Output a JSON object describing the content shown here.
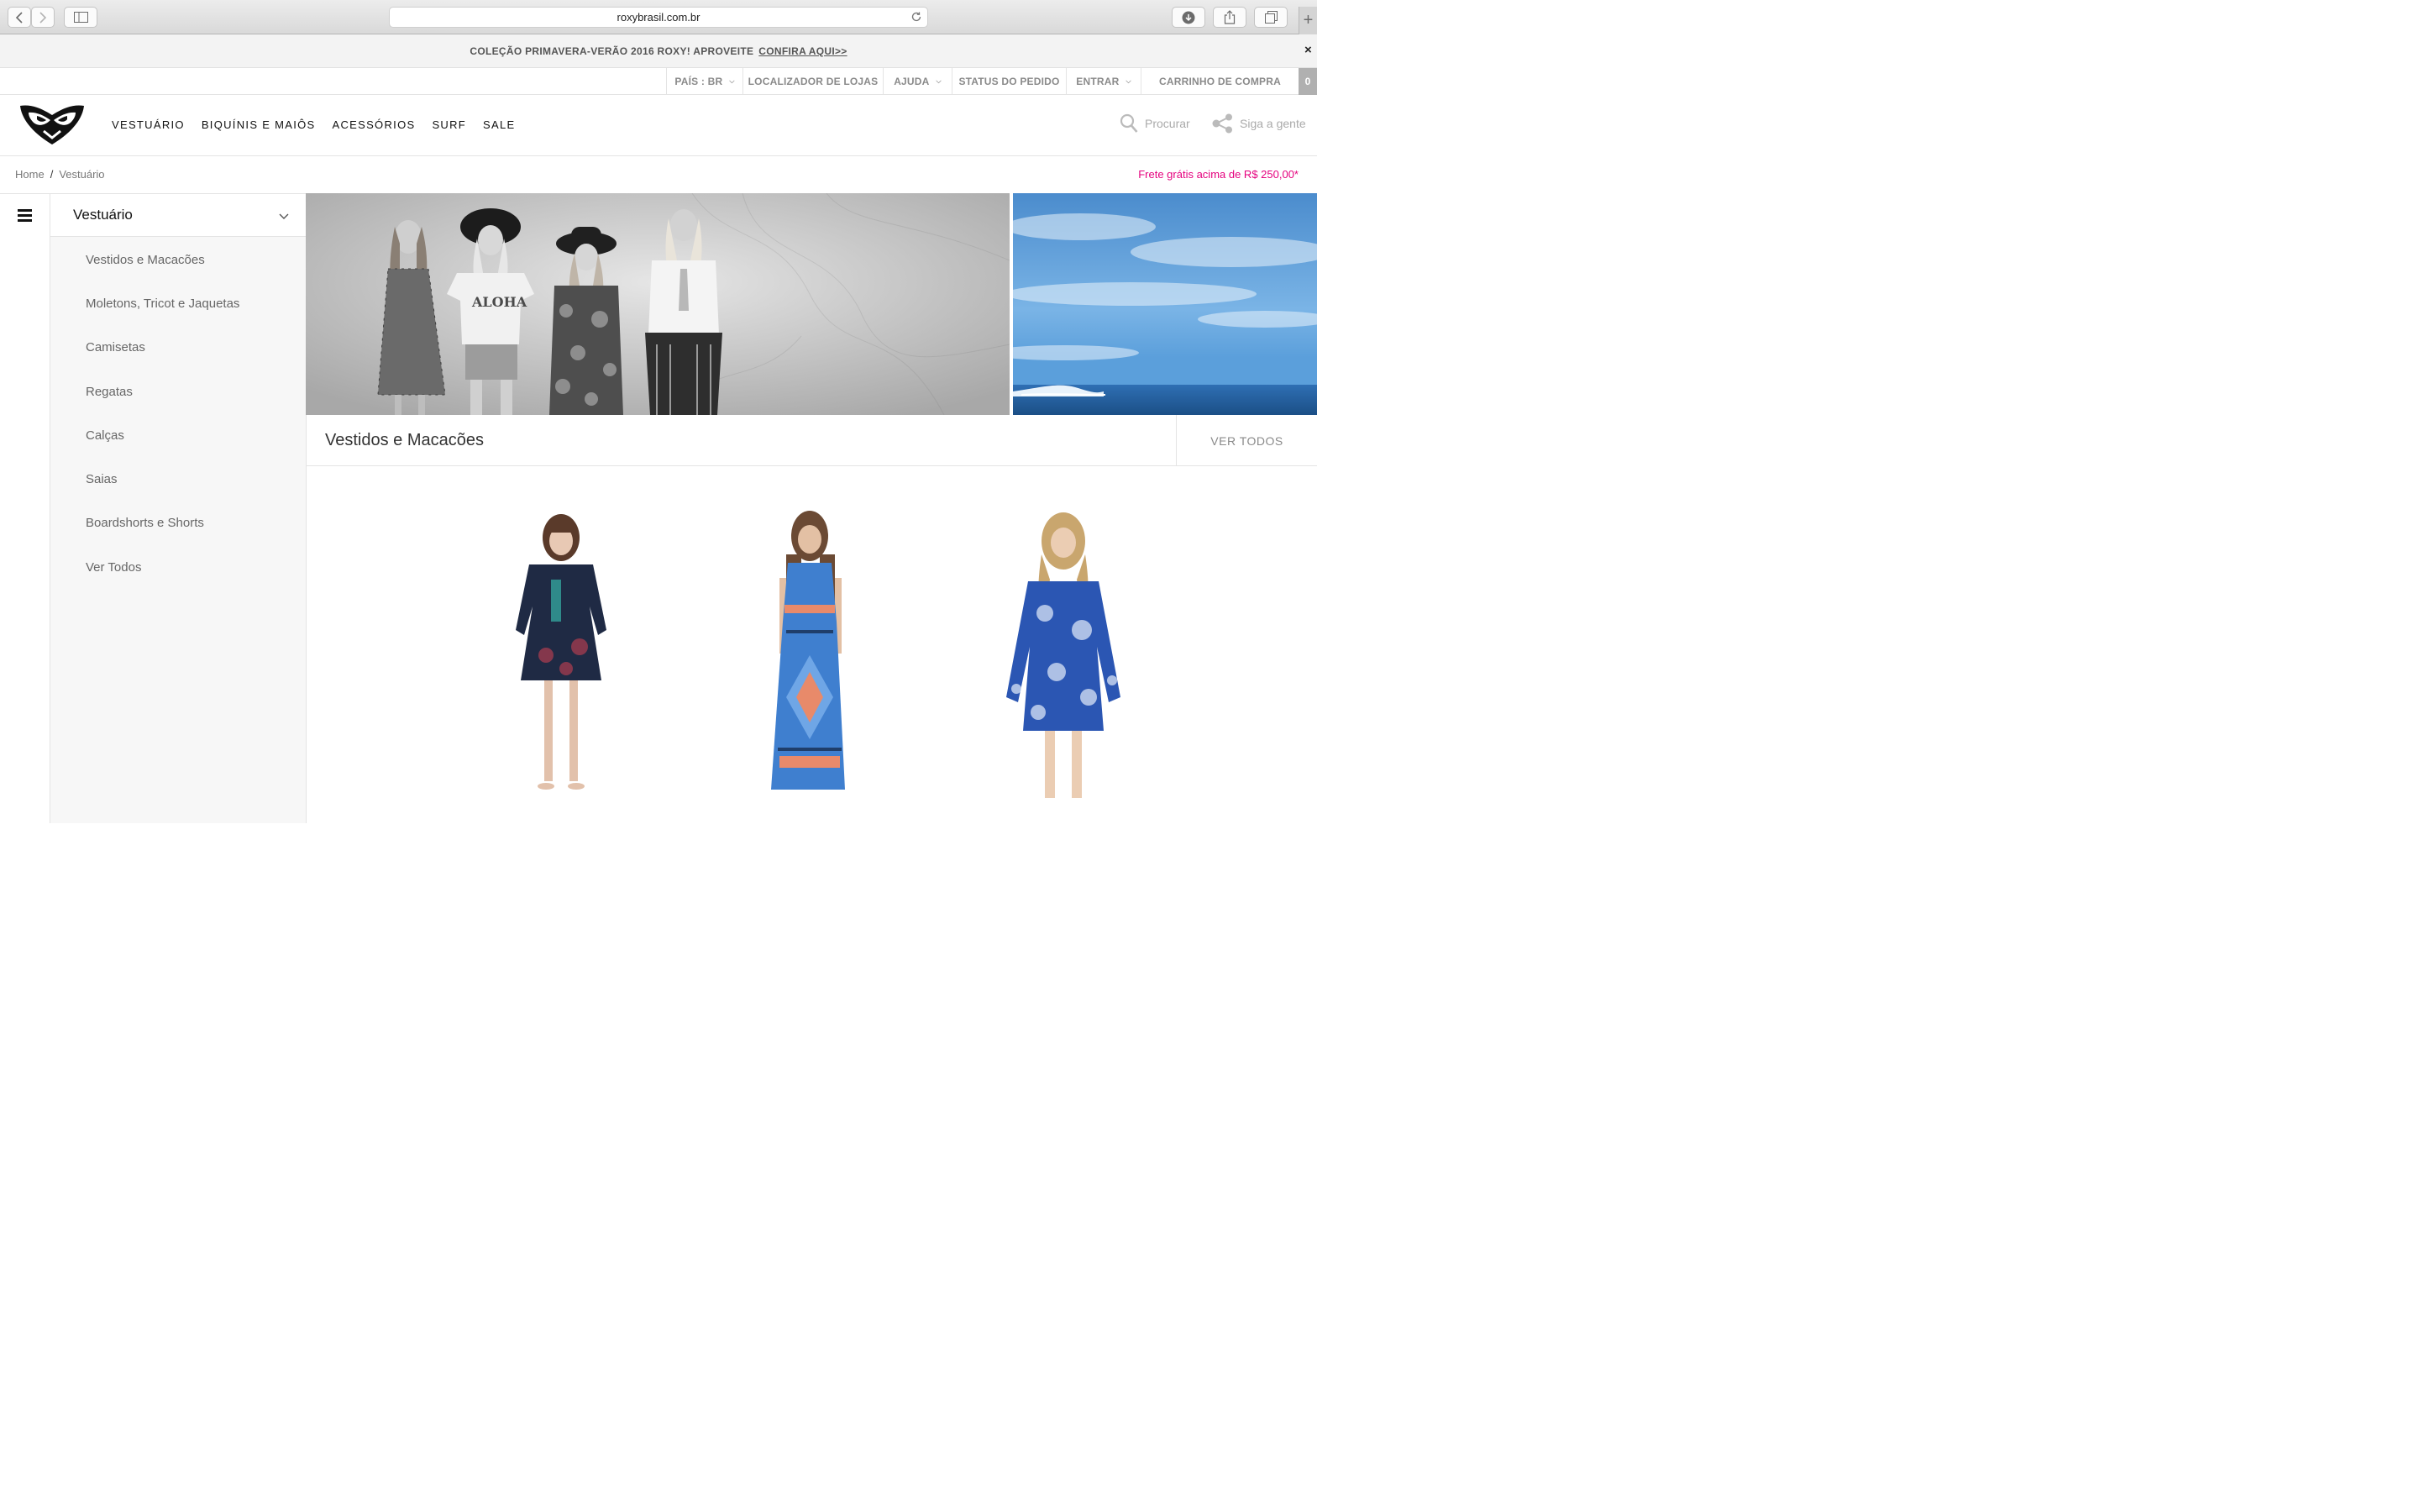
{
  "browser": {
    "url": "roxybrasil.com.br"
  },
  "promo": {
    "text": "COLEÇÃO PRIMAVERA-VERÃO 2016 ROXY! APROVEITE",
    "link": "CONFIRA AQUI>>",
    "close": "×"
  },
  "utility_nav": {
    "country": "PAÍS : BR",
    "stores": "LOCALIZADOR DE LOJAS",
    "help": "AJUDA",
    "order_status": "STATUS DO PEDIDO",
    "login": "ENTRAR",
    "cart": "CARRINHO DE COMPRA",
    "cart_count": "0"
  },
  "main_nav": {
    "items": [
      "VESTUÁRIO",
      "BIQUÍNIS E MAIÔS",
      "ACESSÓRIOS",
      "SURF",
      "SALE"
    ],
    "search": "Procurar",
    "follow": "Siga a gente"
  },
  "breadcrumb": {
    "home": "Home",
    "separator": "/",
    "current": "Vestuário"
  },
  "shipping_note": "Frete grátis acima de R$ 250,00*",
  "category_panel": {
    "title": "Vestuário",
    "items": [
      "Vestidos e Macacões",
      "Moletons, Tricot e Jaquetas",
      "Camisetas",
      "Regatas",
      "Calças",
      "Saias",
      "Boardshorts e Shorts",
      "Ver Todos"
    ]
  },
  "hero": {
    "tshirt_text": "ALOHA"
  },
  "section": {
    "title": "Vestidos e Macacões",
    "view_all": "VER TODOS"
  },
  "colors": {
    "accent_pink": "#e5007e",
    "muted_text": "#8a8a8a"
  }
}
